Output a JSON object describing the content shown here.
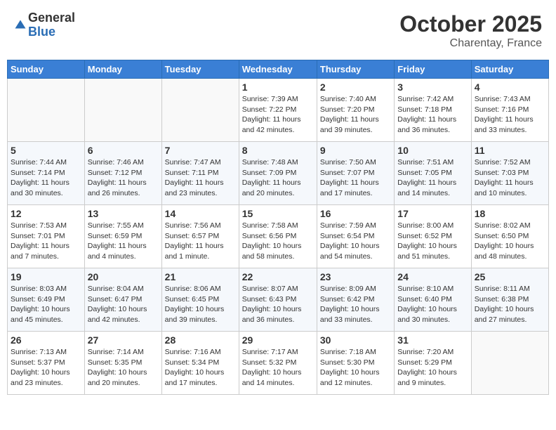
{
  "header": {
    "logo_general": "General",
    "logo_blue": "Blue",
    "month_title": "October 2025",
    "location": "Charentay, France"
  },
  "weekdays": [
    "Sunday",
    "Monday",
    "Tuesday",
    "Wednesday",
    "Thursday",
    "Friday",
    "Saturday"
  ],
  "weeks": [
    [
      {
        "day": "",
        "info": ""
      },
      {
        "day": "",
        "info": ""
      },
      {
        "day": "",
        "info": ""
      },
      {
        "day": "1",
        "info": "Sunrise: 7:39 AM\nSunset: 7:22 PM\nDaylight: 11 hours and 42 minutes."
      },
      {
        "day": "2",
        "info": "Sunrise: 7:40 AM\nSunset: 7:20 PM\nDaylight: 11 hours and 39 minutes."
      },
      {
        "day": "3",
        "info": "Sunrise: 7:42 AM\nSunset: 7:18 PM\nDaylight: 11 hours and 36 minutes."
      },
      {
        "day": "4",
        "info": "Sunrise: 7:43 AM\nSunset: 7:16 PM\nDaylight: 11 hours and 33 minutes."
      }
    ],
    [
      {
        "day": "5",
        "info": "Sunrise: 7:44 AM\nSunset: 7:14 PM\nDaylight: 11 hours and 30 minutes."
      },
      {
        "day": "6",
        "info": "Sunrise: 7:46 AM\nSunset: 7:12 PM\nDaylight: 11 hours and 26 minutes."
      },
      {
        "day": "7",
        "info": "Sunrise: 7:47 AM\nSunset: 7:11 PM\nDaylight: 11 hours and 23 minutes."
      },
      {
        "day": "8",
        "info": "Sunrise: 7:48 AM\nSunset: 7:09 PM\nDaylight: 11 hours and 20 minutes."
      },
      {
        "day": "9",
        "info": "Sunrise: 7:50 AM\nSunset: 7:07 PM\nDaylight: 11 hours and 17 minutes."
      },
      {
        "day": "10",
        "info": "Sunrise: 7:51 AM\nSunset: 7:05 PM\nDaylight: 11 hours and 14 minutes."
      },
      {
        "day": "11",
        "info": "Sunrise: 7:52 AM\nSunset: 7:03 PM\nDaylight: 11 hours and 10 minutes."
      }
    ],
    [
      {
        "day": "12",
        "info": "Sunrise: 7:53 AM\nSunset: 7:01 PM\nDaylight: 11 hours and 7 minutes."
      },
      {
        "day": "13",
        "info": "Sunrise: 7:55 AM\nSunset: 6:59 PM\nDaylight: 11 hours and 4 minutes."
      },
      {
        "day": "14",
        "info": "Sunrise: 7:56 AM\nSunset: 6:57 PM\nDaylight: 11 hours and 1 minute."
      },
      {
        "day": "15",
        "info": "Sunrise: 7:58 AM\nSunset: 6:56 PM\nDaylight: 10 hours and 58 minutes."
      },
      {
        "day": "16",
        "info": "Sunrise: 7:59 AM\nSunset: 6:54 PM\nDaylight: 10 hours and 54 minutes."
      },
      {
        "day": "17",
        "info": "Sunrise: 8:00 AM\nSunset: 6:52 PM\nDaylight: 10 hours and 51 minutes."
      },
      {
        "day": "18",
        "info": "Sunrise: 8:02 AM\nSunset: 6:50 PM\nDaylight: 10 hours and 48 minutes."
      }
    ],
    [
      {
        "day": "19",
        "info": "Sunrise: 8:03 AM\nSunset: 6:49 PM\nDaylight: 10 hours and 45 minutes."
      },
      {
        "day": "20",
        "info": "Sunrise: 8:04 AM\nSunset: 6:47 PM\nDaylight: 10 hours and 42 minutes."
      },
      {
        "day": "21",
        "info": "Sunrise: 8:06 AM\nSunset: 6:45 PM\nDaylight: 10 hours and 39 minutes."
      },
      {
        "day": "22",
        "info": "Sunrise: 8:07 AM\nSunset: 6:43 PM\nDaylight: 10 hours and 36 minutes."
      },
      {
        "day": "23",
        "info": "Sunrise: 8:09 AM\nSunset: 6:42 PM\nDaylight: 10 hours and 33 minutes."
      },
      {
        "day": "24",
        "info": "Sunrise: 8:10 AM\nSunset: 6:40 PM\nDaylight: 10 hours and 30 minutes."
      },
      {
        "day": "25",
        "info": "Sunrise: 8:11 AM\nSunset: 6:38 PM\nDaylight: 10 hours and 27 minutes."
      }
    ],
    [
      {
        "day": "26",
        "info": "Sunrise: 7:13 AM\nSunset: 5:37 PM\nDaylight: 10 hours and 23 minutes."
      },
      {
        "day": "27",
        "info": "Sunrise: 7:14 AM\nSunset: 5:35 PM\nDaylight: 10 hours and 20 minutes."
      },
      {
        "day": "28",
        "info": "Sunrise: 7:16 AM\nSunset: 5:34 PM\nDaylight: 10 hours and 17 minutes."
      },
      {
        "day": "29",
        "info": "Sunrise: 7:17 AM\nSunset: 5:32 PM\nDaylight: 10 hours and 14 minutes."
      },
      {
        "day": "30",
        "info": "Sunrise: 7:18 AM\nSunset: 5:30 PM\nDaylight: 10 hours and 12 minutes."
      },
      {
        "day": "31",
        "info": "Sunrise: 7:20 AM\nSunset: 5:29 PM\nDaylight: 10 hours and 9 minutes."
      },
      {
        "day": "",
        "info": ""
      }
    ]
  ]
}
